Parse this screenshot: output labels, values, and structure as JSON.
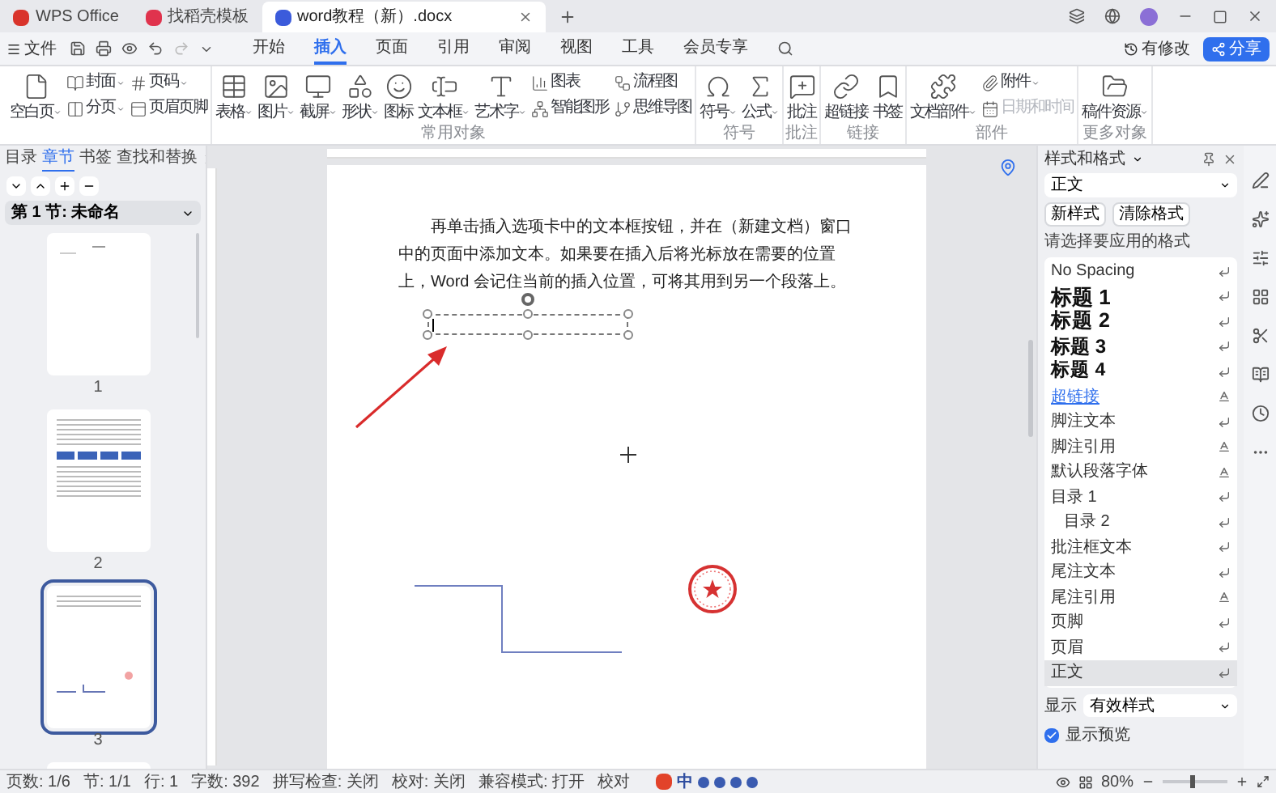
{
  "window_tabs": [
    {
      "label": "WPS Office",
      "selected": false,
      "color": "#d9342b"
    },
    {
      "label": "找稻壳模板",
      "selected": false,
      "color": "#e0334d"
    },
    {
      "label": "word教程（新）.docx",
      "selected": true,
      "color": "#3b5bdb"
    }
  ],
  "menu": {
    "file": "文件",
    "tabs": [
      {
        "label": "开始",
        "selected": false
      },
      {
        "label": "插入",
        "selected": true
      },
      {
        "label": "页面",
        "selected": false
      },
      {
        "label": "引用",
        "selected": false
      },
      {
        "label": "审阅",
        "selected": false
      },
      {
        "label": "视图",
        "selected": false
      },
      {
        "label": "工具",
        "selected": false
      },
      {
        "label": "会员专享",
        "selected": false
      }
    ],
    "changes": "有修改",
    "share": "分享"
  },
  "ribbon": [
    {
      "items": [
        {
          "kind": "large",
          "label": "空白页",
          "dropdown": true,
          "disabled": false
        },
        {
          "kind": "small",
          "label": "封面",
          "dropdown": true,
          "disabled": false
        },
        {
          "kind": "small",
          "label": "分页",
          "dropdown": true,
          "disabled": false
        },
        {
          "kind": "small",
          "label": "页码",
          "dropdown": true,
          "disabled": false
        },
        {
          "kind": "small",
          "label": "页眉页脚",
          "dropdown": false,
          "disabled": false
        }
      ]
    },
    {
      "label": "常用对象",
      "items": [
        {
          "kind": "large",
          "label": "表格",
          "dropdown": true,
          "disabled": false
        },
        {
          "kind": "large",
          "label": "图片",
          "dropdown": true,
          "disabled": false
        },
        {
          "kind": "large",
          "label": "截屏",
          "dropdown": true,
          "disabled": false
        },
        {
          "kind": "large",
          "label": "形状",
          "dropdown": true,
          "disabled": false
        },
        {
          "kind": "large",
          "label": "图标",
          "dropdown": false,
          "disabled": false
        },
        {
          "kind": "large",
          "label": "文本框",
          "dropdown": true,
          "disabled": false
        },
        {
          "kind": "large",
          "label": "艺术字",
          "dropdown": true,
          "disabled": false
        },
        {
          "kind": "small",
          "label": "图表",
          "dropdown": false,
          "disabled": false
        },
        {
          "kind": "small",
          "label": "智能图形",
          "dropdown": false,
          "disabled": false
        },
        {
          "kind": "small",
          "label": "流程图",
          "dropdown": false,
          "disabled": false
        },
        {
          "kind": "small",
          "label": "思维导图",
          "dropdown": false,
          "disabled": false
        }
      ]
    },
    {
      "label": "符号",
      "items": [
        {
          "kind": "large",
          "label": "符号",
          "dropdown": true,
          "disabled": false
        },
        {
          "kind": "large",
          "label": "公式",
          "dropdown": true,
          "disabled": false
        }
      ]
    },
    {
      "label": "批注",
      "items": [
        {
          "kind": "large",
          "label": "批注",
          "dropdown": false,
          "disabled": false
        }
      ]
    },
    {
      "label": "链接",
      "items": [
        {
          "kind": "large",
          "label": "超链接",
          "dropdown": false,
          "disabled": false
        },
        {
          "kind": "large",
          "label": "书签",
          "dropdown": false,
          "disabled": false
        }
      ]
    },
    {
      "label": "部件",
      "items": [
        {
          "kind": "large",
          "label": "文档部件",
          "dropdown": true,
          "disabled": false
        },
        {
          "kind": "small",
          "label": "附件",
          "dropdown": true,
          "disabled": false
        },
        {
          "kind": "small",
          "label": "日期和时间",
          "dropdown": false,
          "disabled": true
        }
      ]
    },
    {
      "label": "更多对象",
      "items": [
        {
          "kind": "large",
          "label": "稿件资源",
          "dropdown": true,
          "disabled": false
        }
      ]
    }
  ],
  "nav_panel": {
    "tabs": [
      {
        "label": "目录",
        "selected": false
      },
      {
        "label": "章节",
        "selected": true
      },
      {
        "label": "书签",
        "selected": false
      },
      {
        "label": "查找和替换",
        "selected": false
      }
    ],
    "section": "第 1 节: 未命名",
    "pages": [
      {
        "number": "1",
        "selected": false
      },
      {
        "number": "2",
        "selected": false
      },
      {
        "number": "3",
        "selected": true
      },
      {
        "selected": false
      }
    ]
  },
  "document": {
    "paragraph": "再单击插入选项卡中的文本框按钮，并在（新建文档）窗口中的页面中添加文本。如果要在插入后将光标放在需要的位置上，Word 会记住当前的插入位置，可将其用到另一个段落上。"
  },
  "styles_panel": {
    "title": "样式和格式",
    "current": "正文",
    "new_style": "新样式",
    "clear_format": "清除格式",
    "prompt": "请选择要应用的格式",
    "styles": [
      {
        "label": "No Spacing",
        "kind": "normal",
        "character_style": false,
        "selected": false
      },
      {
        "label": "标题 1",
        "kind": "heading1",
        "character_style": false,
        "selected": false
      },
      {
        "label": "标题 2",
        "kind": "heading2",
        "character_style": false,
        "selected": false
      },
      {
        "label": "标题 3",
        "kind": "heading3",
        "character_style": false,
        "selected": false
      },
      {
        "label": "标题 4",
        "kind": "heading4",
        "character_style": false,
        "selected": false
      },
      {
        "label": "超链接",
        "kind": "link",
        "character_style": true,
        "selected": false
      },
      {
        "label": "脚注文本",
        "kind": "normal",
        "character_style": false,
        "selected": false
      },
      {
        "label": "脚注引用",
        "kind": "normal",
        "character_style": true,
        "selected": false
      },
      {
        "label": "默认段落字体",
        "kind": "normal",
        "character_style": true,
        "selected": false
      },
      {
        "label": "目录 1",
        "kind": "normal",
        "character_style": false,
        "selected": false
      },
      {
        "label": "目录 2",
        "kind": "indent",
        "character_style": false,
        "selected": false
      },
      {
        "label": "批注框文本",
        "kind": "normal",
        "character_style": false,
        "selected": false
      },
      {
        "label": "尾注文本",
        "kind": "normal",
        "character_style": false,
        "selected": false
      },
      {
        "label": "尾注引用",
        "kind": "normal",
        "character_style": true,
        "selected": false
      },
      {
        "label": "页脚",
        "kind": "normal",
        "character_style": false,
        "selected": false
      },
      {
        "label": "页眉",
        "kind": "normal",
        "character_style": false,
        "selected": false
      },
      {
        "label": "正文",
        "kind": "normal",
        "character_style": false,
        "selected": true
      }
    ],
    "show_label": "显示",
    "show_value": "有效样式",
    "preview": {
      "label": "显示预览",
      "checked": true
    }
  },
  "ime": {
    "label": "中"
  },
  "status_bar": {
    "items": [
      "页数: 1/6",
      "节: 1/1",
      "行: 1",
      "字数: 392",
      "拼写检查: 关闭",
      "校对: 关闭",
      "兼容模式: 打开",
      "校对"
    ],
    "zoom": "80%",
    "zoom_level": {
      "level": 0.45
    }
  }
}
